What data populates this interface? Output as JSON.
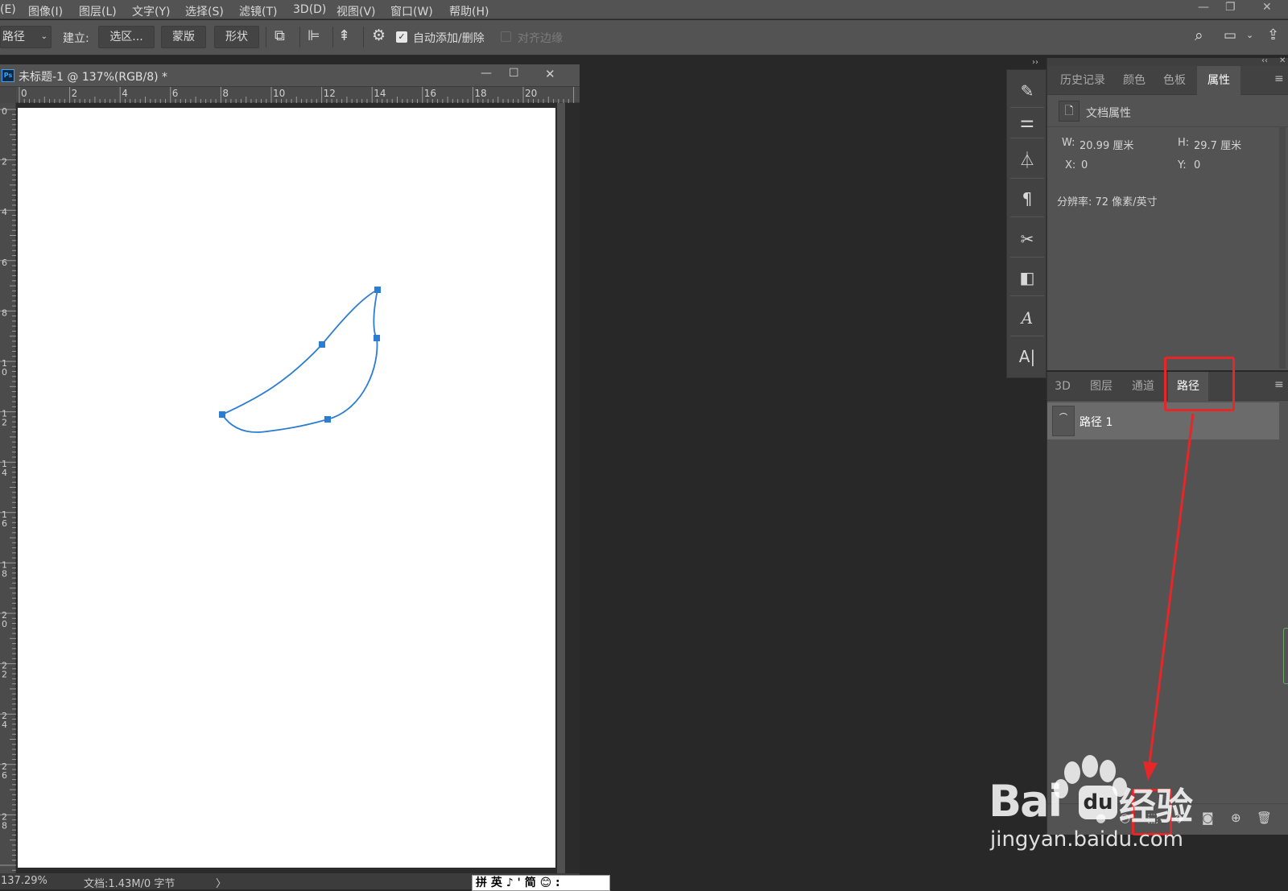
{
  "menu": [
    "(E)",
    "图像(I)",
    "图层(L)",
    "文字(Y)",
    "选择(S)",
    "滤镜(T)",
    "3D(D)",
    "视图(V)",
    "窗口(W)",
    "帮助(H)"
  ],
  "options_bar": {
    "mode_value": "路径",
    "make_label": "建立:",
    "selection_button": "选区...",
    "mask_button": "蒙版",
    "shape_button": "形状",
    "auto_add_delete": "自动添加/删除",
    "auto_add_delete_checked": true,
    "align_edges": "对齐边缘",
    "align_edges_checked": false
  },
  "document": {
    "title": "未标题-1 @ 137%(RGB/8) *",
    "ruler_top": [
      "0",
      "2",
      "4",
      "6",
      "8",
      "10",
      "12",
      "14",
      "16",
      "18",
      "20"
    ],
    "ruler_left": [
      "0",
      "2",
      "4",
      "6",
      "8",
      "1\n0",
      "1\n2",
      "1\n4",
      "1\n6",
      "1\n8",
      "2\n0",
      "2\n2",
      "2\n4",
      "2\n6",
      "2\n8"
    ],
    "path_color": "#2b7cd3",
    "zoom": "137.29%",
    "doc_info": "文档:1.43M/0 字节",
    "status_arrow": "〉"
  },
  "properties_panel": {
    "tabs": [
      "历史记录",
      "颜色",
      "色板",
      "属性"
    ],
    "active_tab": "属性",
    "section_title": "文档属性",
    "w_label": "W:",
    "w_value": "20.99 厘米",
    "h_label": "H:",
    "h_value": "29.7 厘米",
    "x_label": "X:",
    "x_value": "0",
    "y_label": "Y:",
    "y_value": "0",
    "resolution": "分辨率: 72 像素/英寸"
  },
  "paths_panel": {
    "tabs": [
      "3D",
      "图层",
      "通道",
      "路径"
    ],
    "active_tab": "路径",
    "items": [
      {
        "name": "路径 1"
      }
    ]
  },
  "annotation_color": "#e52727",
  "watermark": {
    "logo": "Bai",
    "logo_cn": "经验",
    "url": "jingyan.baidu.com"
  },
  "ime_bar": "拼 英 ♪ ' 简 😊 :"
}
